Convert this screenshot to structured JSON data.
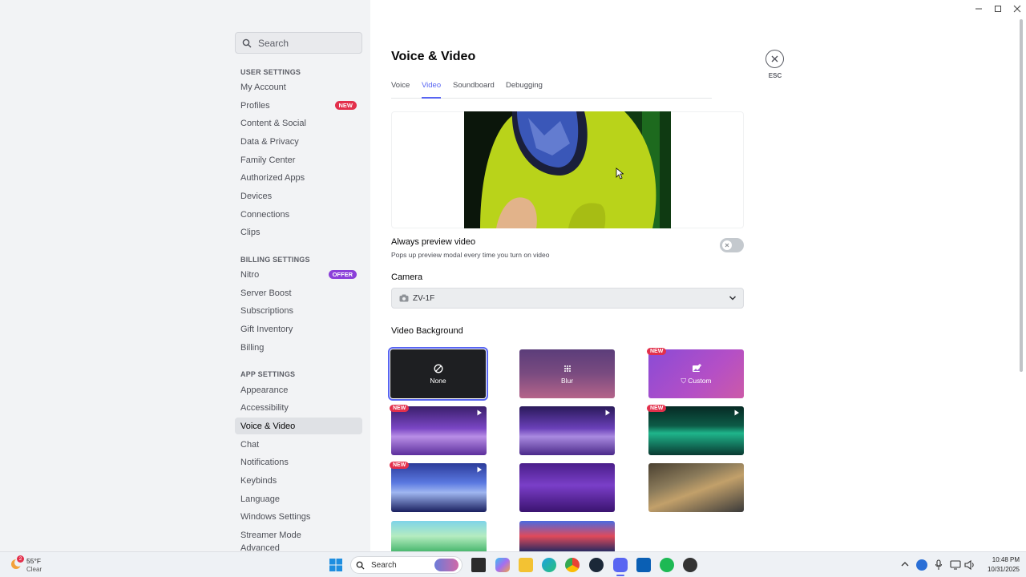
{
  "sidebar": {
    "search_placeholder": "Search",
    "sections": {
      "user": "USER SETTINGS",
      "billing": "BILLING SETTINGS",
      "app": "APP SETTINGS"
    },
    "user_items": [
      "My Account",
      "Profiles",
      "Content & Social",
      "Data & Privacy",
      "Family Center",
      "Authorized Apps",
      "Devices",
      "Connections",
      "Clips"
    ],
    "billing_items": [
      "Nitro",
      "Server Boost",
      "Subscriptions",
      "Gift Inventory",
      "Billing"
    ],
    "app_items": [
      "Appearance",
      "Accessibility",
      "Voice & Video",
      "Chat",
      "Notifications",
      "Keybinds",
      "Language",
      "Windows Settings",
      "Streamer Mode",
      "Advanced"
    ],
    "profiles_badge": "NEW",
    "nitro_badge": "OFFER"
  },
  "main": {
    "title": "Voice & Video",
    "tabs": [
      "Voice",
      "Video",
      "Soundboard",
      "Debugging"
    ],
    "active_tab": "Video",
    "esc_label": "ESC",
    "always_preview": {
      "label": "Always preview video",
      "description": "Pops up preview modal every time you turn on video",
      "enabled": false
    },
    "camera": {
      "label": "Camera",
      "selected": "ZV-1F"
    },
    "video_background": {
      "label": "Video Background",
      "none_label": "None",
      "blur_label": "Blur",
      "custom_label": "Custom",
      "new_tag": "NEW"
    }
  },
  "taskbar": {
    "weather_temp": "55°F",
    "weather_cond": "Clear",
    "weather_badge": "2",
    "search_label": "Search",
    "time": "10:48 PM",
    "date": "10/31/2025"
  },
  "colors": {
    "accent": "#5865f2",
    "badge_new": "#e3304c",
    "badge_offer": "#8b3fd9"
  }
}
